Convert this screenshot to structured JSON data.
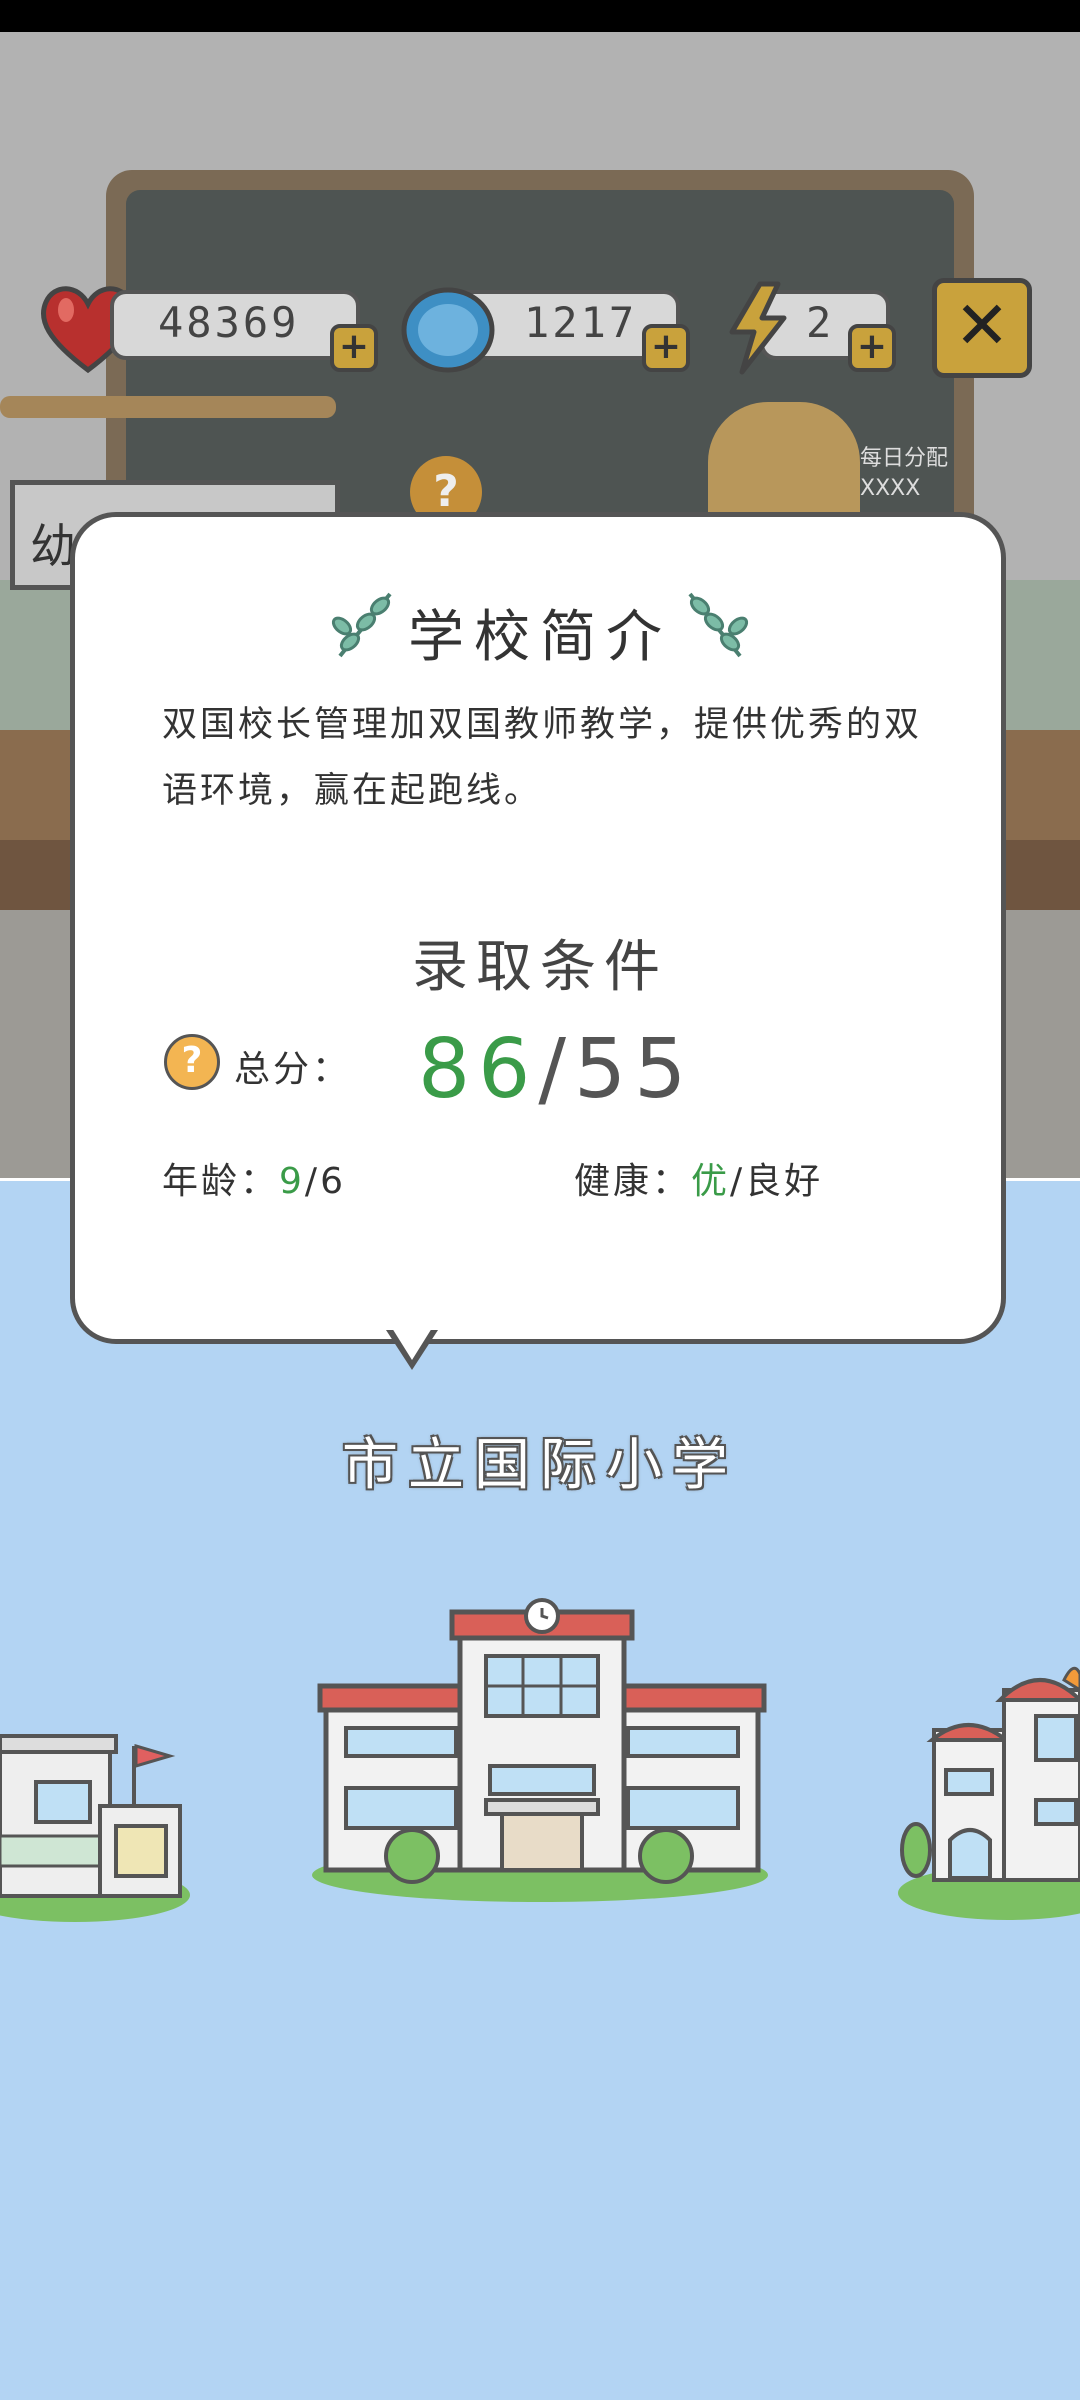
{
  "hud": {
    "hearts": "48369",
    "coins": "1217",
    "energy": "2",
    "close_symbol": "✕",
    "plus_symbol": "+"
  },
  "background": {
    "sign_text": "幼",
    "help_symbol": "?",
    "board_text_1": "每日分配",
    "board_text_2": "XXXX"
  },
  "popup": {
    "title": "学校简介",
    "description": "双国校长管理加双国教师教学，提供优秀的双语环境，赢在起跑线。",
    "conditions_title": "录取条件",
    "help_symbol": "?",
    "total_label": "总分：",
    "score_current": "86",
    "score_required": "55",
    "score_sep": "/",
    "age_label": "年龄：",
    "age_current": "9",
    "age_required": "6",
    "health_label": "健康：",
    "health_current": "优",
    "health_required": "良好"
  },
  "school": {
    "name": "市立国际小学"
  },
  "colors": {
    "ok_green": "#3a9b48",
    "sky_blue": "#b3d4f3",
    "gold": "#c9a23c"
  }
}
